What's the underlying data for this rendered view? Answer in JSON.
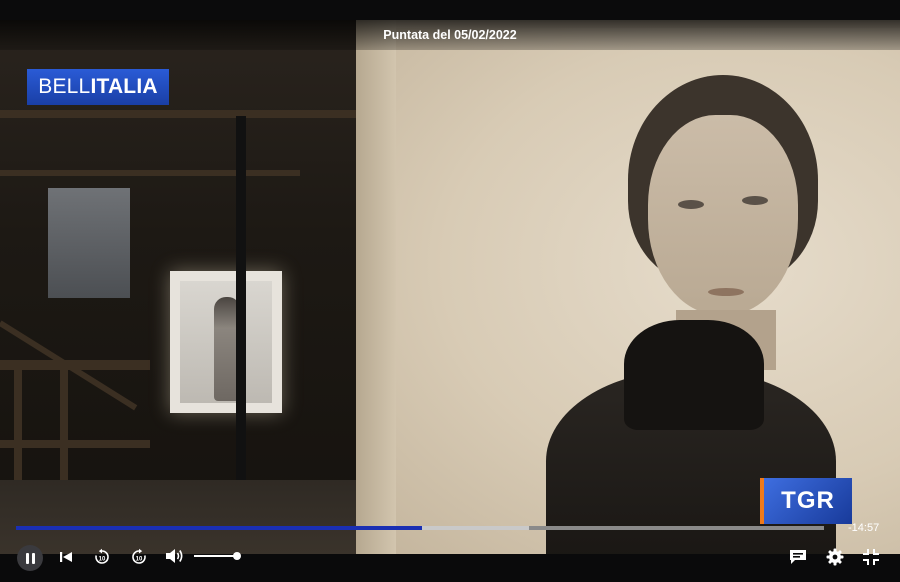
{
  "header": {
    "title": "Puntata del 05/02/2022"
  },
  "overlays": {
    "channel_logo": {
      "part1": "BELL",
      "part2": "ITALIA"
    },
    "broadcaster_logo": {
      "text": "TGR"
    }
  },
  "player": {
    "state": "playing",
    "progress_fraction": 0.502,
    "buffered_fraction": 0.635,
    "remaining_time": "-14:57",
    "volume_fraction": 1.0
  },
  "controls": {
    "pause": "pause-icon",
    "previous": "skip-previous-icon",
    "rewind": "replay-10-icon",
    "forward": "forward-10-icon",
    "volume": "volume-icon",
    "subtitles": "subtitles-icon",
    "settings": "gear-icon",
    "fullscreen": "exit-fullscreen-icon"
  },
  "colors": {
    "progress": "#1a2fb3",
    "logo_blue": "#2a5bd6",
    "tgr_accent": "#f07a1a"
  }
}
